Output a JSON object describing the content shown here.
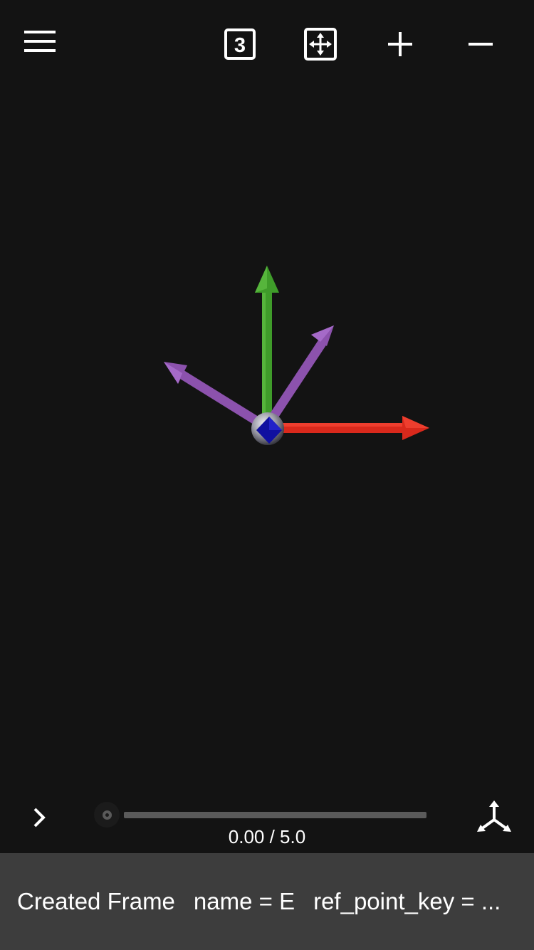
{
  "toolbar": {
    "menu_icon": "hamburger-menu-icon",
    "view_3d_label": "3",
    "fit_icon": "fit-to-screen-icon",
    "zoom_in_icon": "plus-icon",
    "zoom_out_icon": "minus-icon"
  },
  "scene": {
    "background": "#131313",
    "axis_x_color": "#d9291c",
    "axis_y_color": "#3f9c2a",
    "vector_color": "#8c52ad",
    "origin_color": "#1010a0"
  },
  "playback": {
    "play_icon": "chevron-right-icon",
    "time_display": "0.00 / 5.0",
    "current_time": 0.0,
    "duration": 5.0,
    "axes_icon": "coordinate-axes-icon"
  },
  "status": {
    "message": "Created Frame",
    "name_text": "name = E",
    "ref_text": "ref_point_key = ..."
  }
}
